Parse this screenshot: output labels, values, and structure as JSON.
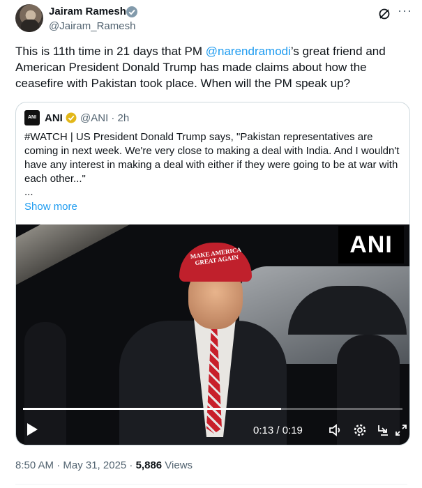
{
  "author": {
    "name": "Jairam Ramesh",
    "handle": "@Jairam_Ramesh"
  },
  "header": {
    "more_label": "···"
  },
  "tweet": {
    "text_before": "This is 11th time in 21 days that PM ",
    "mention": "@narendramodi",
    "text_after": "’s great friend and American President Donald Trump has made claims about how the ceasefire with Pakistan took place. When will the PM speak up?"
  },
  "quote": {
    "logo_text": "ANI",
    "name": "ANI",
    "handle_time": "@ANI · 2h",
    "text": "#WATCH | US President Donald Trump says, \"Pakistan representatives are coming in next week. We're very close to making a deal with India. And I wouldn't have any interest in making a deal with either if they were going to be at war with each other...\"",
    "ellipsis": "...",
    "show_more": "Show more",
    "video": {
      "watermark": "ANI",
      "cap_text": "MAKE AMERICA GREAT AGAIN",
      "time": "0:13 / 0:19",
      "progress": 0.68
    }
  },
  "footer": {
    "timestamp": "8:50 AM · May 31, 2025 · ",
    "views_count": "5,886",
    "views_label": " Views"
  },
  "colors": {
    "accent": "#1d9bf0",
    "badge_gold": "#e2b719",
    "badge_grey": "#829aab"
  }
}
